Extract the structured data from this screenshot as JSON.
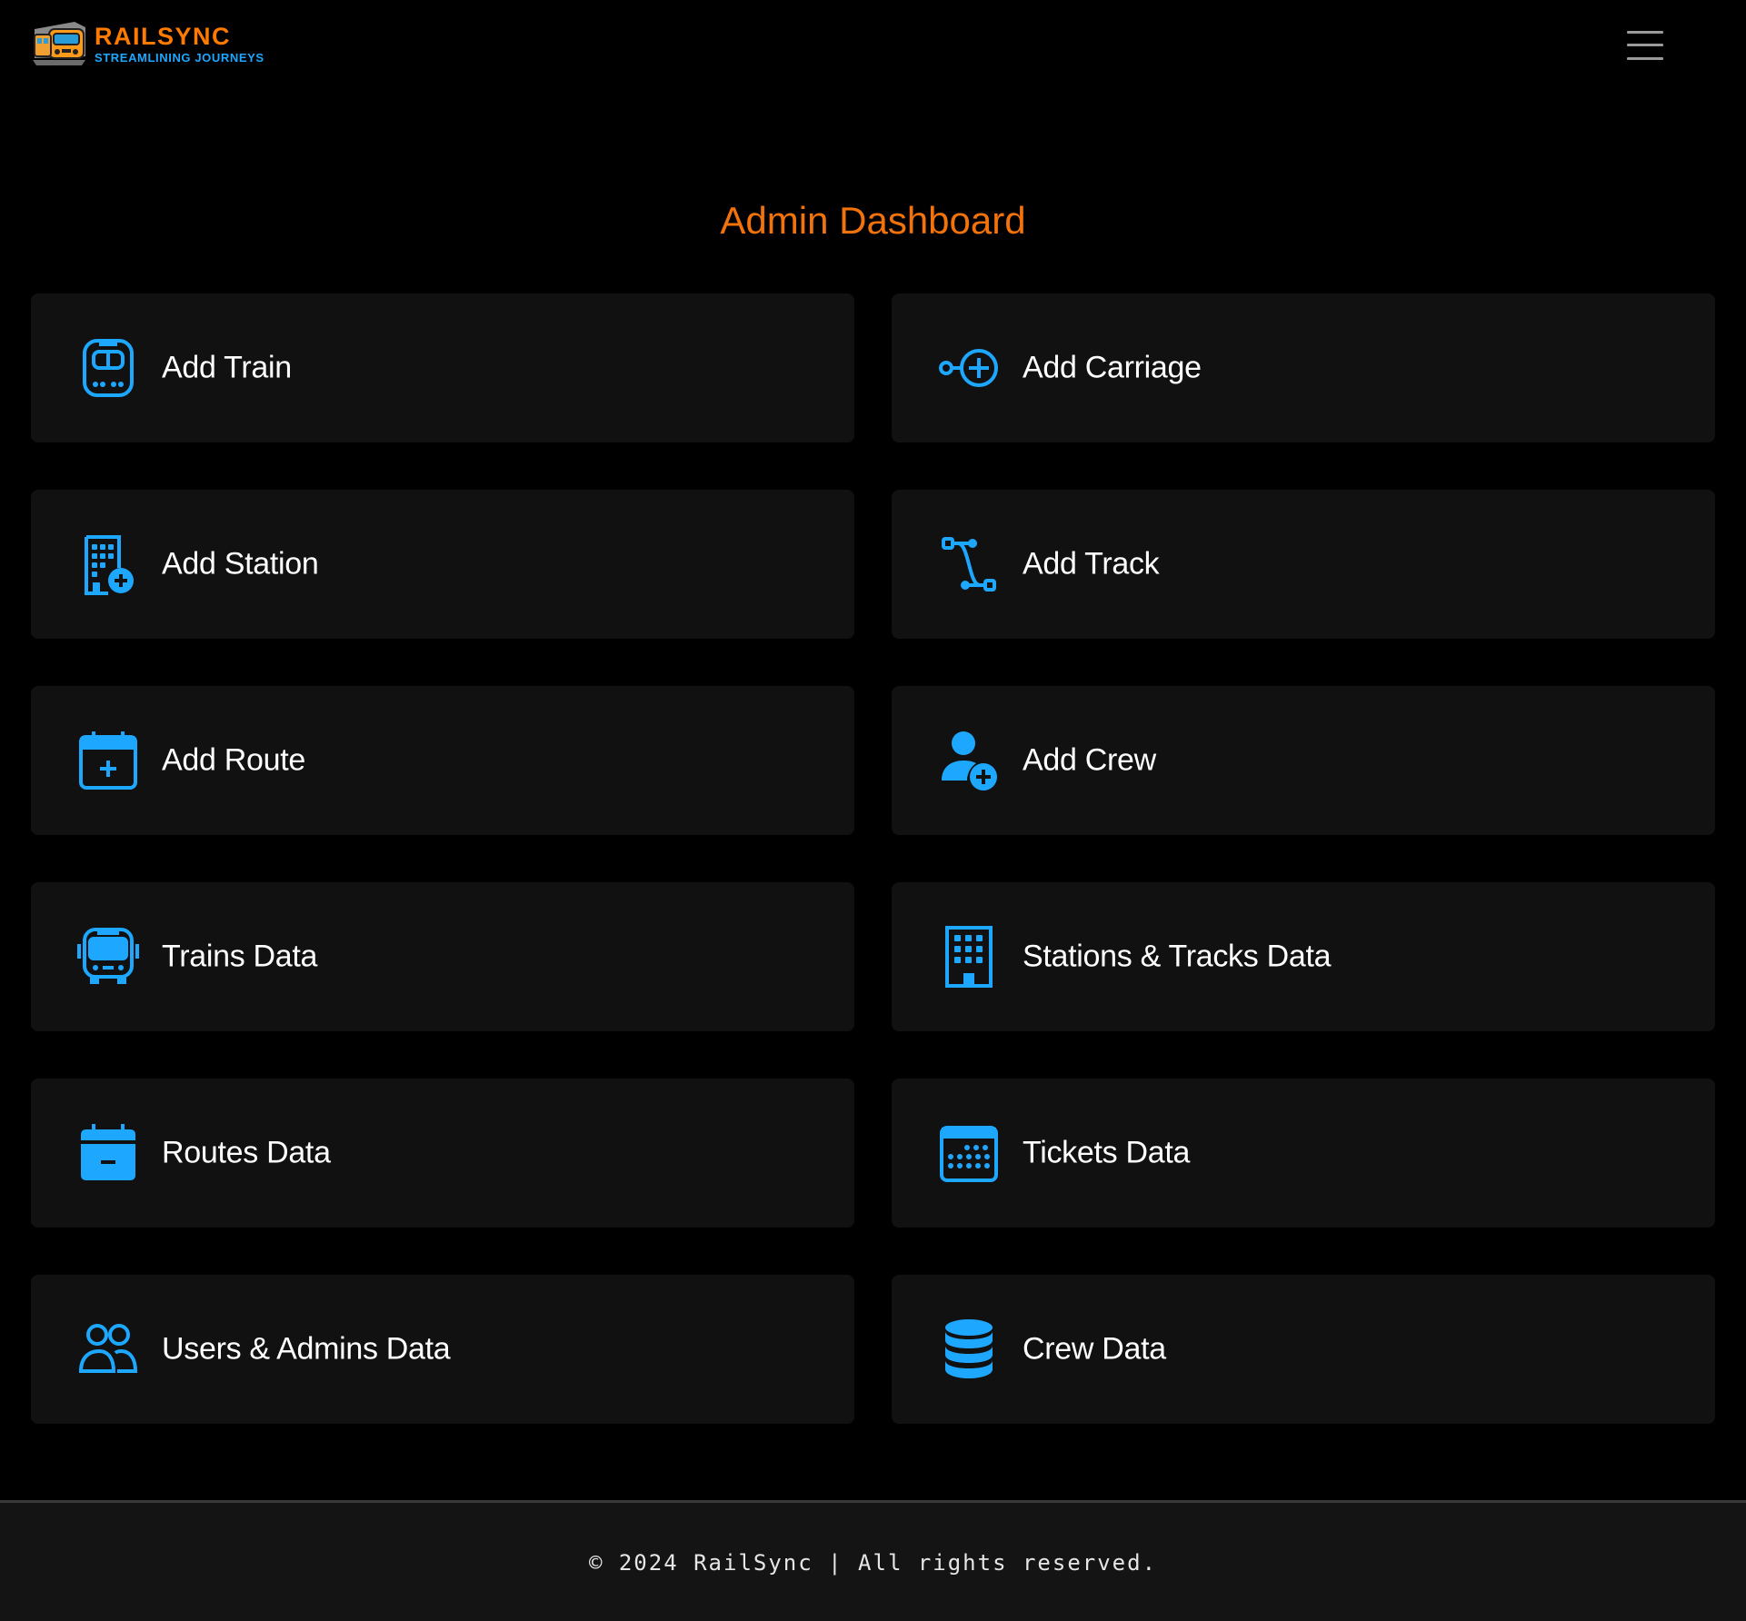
{
  "colors": {
    "background": "#000000",
    "card_background": "#111111",
    "accent_orange": "#f2720c",
    "icon_blue": "#1ea7ff",
    "text_white": "#ffffff",
    "footer_background": "#141414"
  },
  "header": {
    "logo": {
      "icon": "train-front-icon",
      "name": "RAILSYNC",
      "tagline": "STREAMLINING JOURNEYS"
    },
    "menu_icon": "hamburger-menu-icon"
  },
  "main": {
    "title": "Admin Dashboard",
    "cards": [
      {
        "label": "Add Train",
        "icon": "train-front-icon"
      },
      {
        "label": "Add Carriage",
        "icon": "node-plus-icon"
      },
      {
        "label": "Add Station",
        "icon": "building-add-icon"
      },
      {
        "label": "Add Track",
        "icon": "bezier-path-icon"
      },
      {
        "label": "Add Route",
        "icon": "calendar-plus-icon"
      },
      {
        "label": "Add Crew",
        "icon": "person-plus-icon"
      },
      {
        "label": "Trains Data",
        "icon": "bus-front-icon"
      },
      {
        "label": "Stations & Tracks Data",
        "icon": "building-icon"
      },
      {
        "label": "Routes Data",
        "icon": "calendar-minus-icon"
      },
      {
        "label": "Tickets Data",
        "icon": "calendar-dots-icon"
      },
      {
        "label": "Users & Admins Data",
        "icon": "people-icon"
      },
      {
        "label": "Crew Data",
        "icon": "database-icon"
      }
    ]
  },
  "footer": {
    "text": "© 2024 RailSync | All rights reserved."
  }
}
